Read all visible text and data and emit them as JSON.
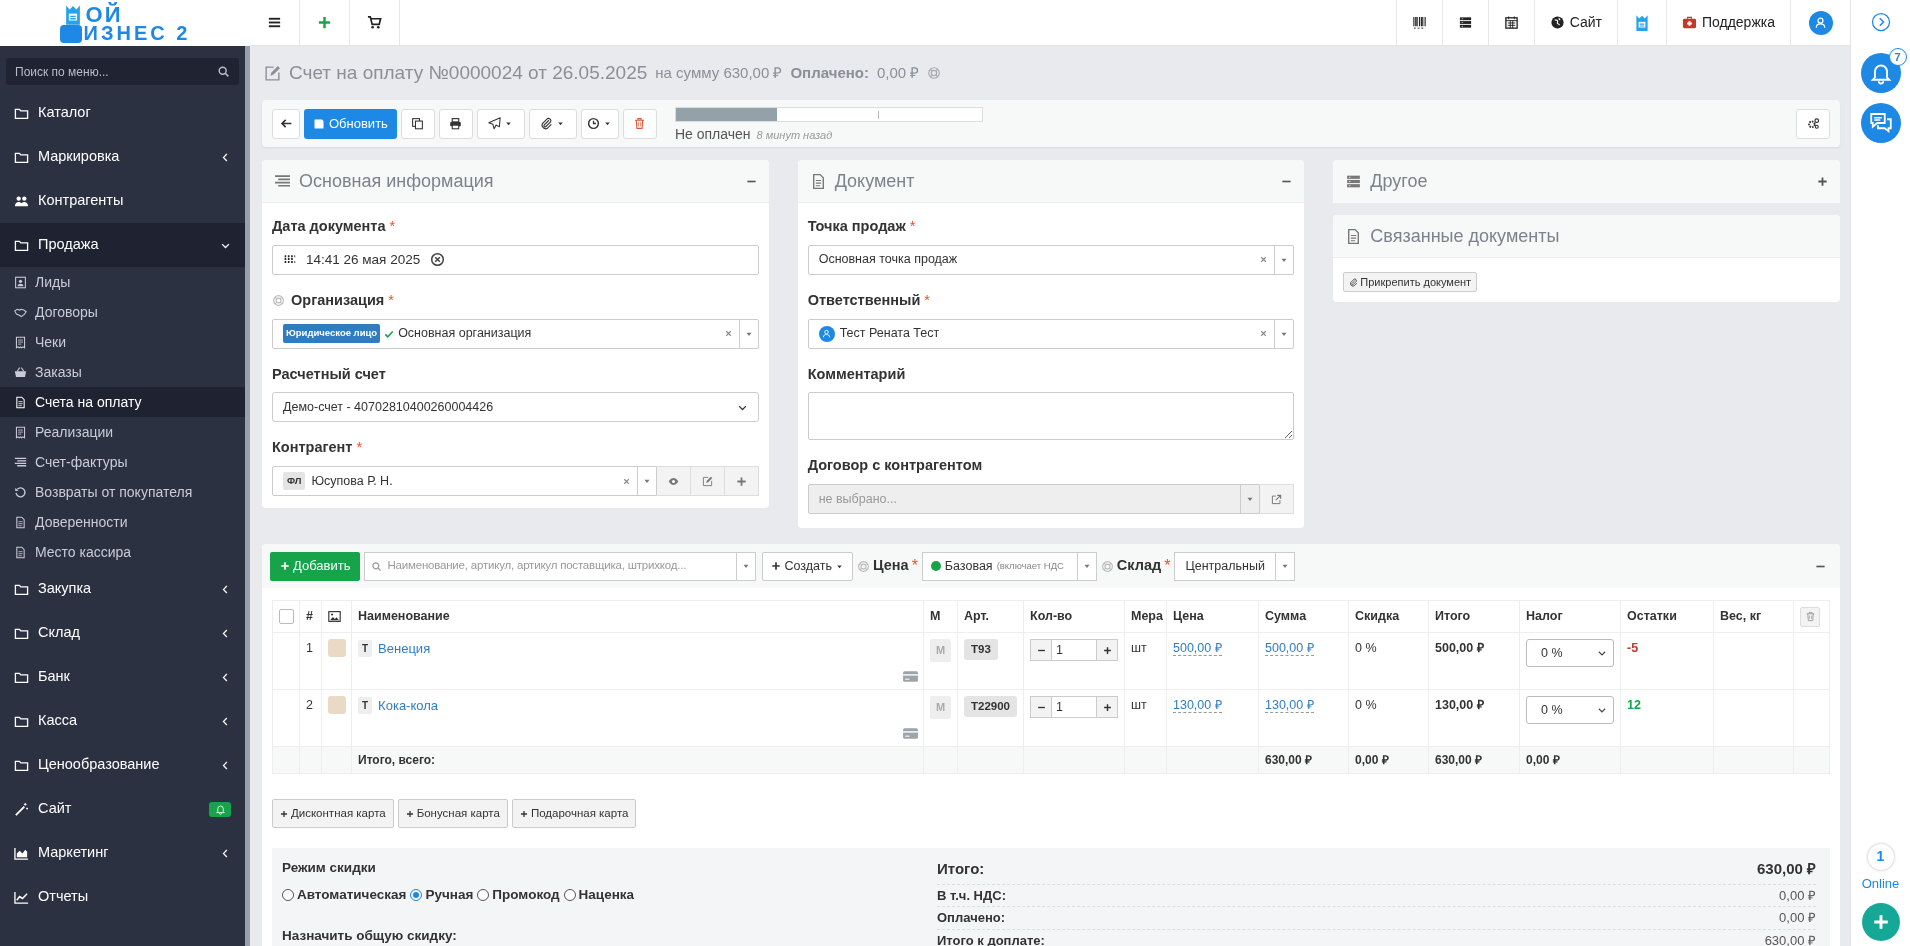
{
  "logo": {
    "line1": "ОЙ",
    "line2": "ИЗНЕС 2"
  },
  "topbar": {
    "right": [
      {
        "kind": "barcode"
      },
      {
        "kind": "list"
      },
      {
        "kind": "calendar"
      },
      {
        "kind": "globe",
        "label": "Сайт"
      },
      {
        "kind": "mascot"
      },
      {
        "kind": "support",
        "label": "Поддержка"
      },
      {
        "kind": "avatar"
      }
    ]
  },
  "sidebar": {
    "search": {
      "placeholder": "Поиск по меню..."
    },
    "items": [
      {
        "label": "Каталог",
        "kind": "link",
        "selected": false
      },
      {
        "label": "Маркировка",
        "kind": "group",
        "expanded": false,
        "selected": false
      },
      {
        "label": "Контрагенты",
        "kind": "link",
        "selected": false
      },
      {
        "label": "Продажа",
        "kind": "group",
        "expanded": true,
        "selected": true,
        "children": [
          {
            "label": "Лиды",
            "selected": false
          },
          {
            "label": "Договоры",
            "selected": false
          },
          {
            "label": "Чеки",
            "selected": false
          },
          {
            "label": "Заказы",
            "selected": false
          },
          {
            "label": "Счета на оплату",
            "selected": true
          },
          {
            "label": "Реализации",
            "selected": false
          },
          {
            "label": "Счет-фактуры",
            "selected": false
          },
          {
            "label": "Возвраты от покупателя",
            "selected": false
          },
          {
            "label": "Доверенности",
            "selected": false
          },
          {
            "label": "Место кассира",
            "selected": false
          }
        ]
      },
      {
        "label": "Закупка",
        "kind": "group",
        "expanded": false,
        "selected": false
      },
      {
        "label": "Склад",
        "kind": "group",
        "expanded": false,
        "selected": false
      },
      {
        "label": "Банк",
        "kind": "group",
        "expanded": false,
        "selected": false
      },
      {
        "label": "Касса",
        "kind": "group",
        "expanded": false,
        "selected": false
      },
      {
        "label": "Ценообразование",
        "kind": "group",
        "expanded": false,
        "selected": false
      },
      {
        "label": "Сайт",
        "kind": "badge",
        "selected": false
      },
      {
        "label": "Маркетинг",
        "kind": "group",
        "expanded": false,
        "selected": false
      },
      {
        "label": "Отчеты",
        "kind": "link",
        "selected": false
      }
    ]
  },
  "header": {
    "title": "Счет на оплату №0000024 от 26.05.2025",
    "amount": "на сумму 630,00 ₽",
    "paid_label": "Оплачено:",
    "paid_value": "0,00 ₽"
  },
  "toolbar": {
    "refresh": "Обновить",
    "progress": {
      "level": 0.33
    },
    "status": "Не оплачен",
    "time": "8 минут назад"
  },
  "main_info": {
    "title": "Основная информация",
    "collapsed": false,
    "date": {
      "label": "Дата документа",
      "required_mark": "*",
      "value": "14:41 26 мая 2025"
    },
    "organization": {
      "label": "Организация",
      "required_mark": "*",
      "tag": "Юридическое лицо",
      "value": "Основная организация"
    },
    "account": {
      "label": "Расчетный счет",
      "value": "Демо-счет - 40702810400260004426"
    },
    "counterparty": {
      "label": "Контрагент",
      "required_mark": "*",
      "tag": "ФЛ",
      "value": "Юсупова Р. Н."
    }
  },
  "document": {
    "title": "Документ",
    "collapsed": false,
    "point": {
      "label": "Точка продаж",
      "required_mark": "*",
      "value": "Основная точка продаж"
    },
    "responsible": {
      "label": "Ответственный",
      "required_mark": "*",
      "value": "Тест Рената Тест"
    },
    "comment": {
      "label": "Комментарий"
    },
    "contract": {
      "label": "Договор с контрагентом",
      "placeholder": "не выбрано...",
      "disabled": true
    }
  },
  "other": {
    "title": "Другое",
    "collapsed": true
  },
  "related": {
    "title": "Связанные документы",
    "button": "Прикрепить документ"
  },
  "products": {
    "add": "Добавить",
    "search_placeholder": "Наименование, артикул, артикул поставщика, штрихкод...",
    "create": "Создать",
    "price_label": "Цена",
    "price_mark": "*",
    "price_value": "Базовая",
    "price_note": "(включает НДС",
    "warehouse_label": "Склад",
    "warehouse_mark": "*",
    "warehouse_value": "Центральный",
    "select_all": {
      "checked": false
    },
    "columns": [
      "#",
      "Наименование",
      "М",
      "Арт.",
      "Кол-во",
      "Мера",
      "Цена",
      "Сумма",
      "Скидка",
      "Итого",
      "Налог",
      "Остатки",
      "Вес, кг"
    ],
    "rows": [
      {
        "num": "1",
        "type": "Т",
        "name": "Венеция",
        "mark": "М",
        "article": "Т93",
        "qty": "1",
        "unit": "шт",
        "price": "500,00 ₽",
        "sum": "500,00 ₽",
        "discount": "0 %",
        "total": "500,00 ₽",
        "tax": "0 %",
        "stock": "-5",
        "color": "#c0392b"
      },
      {
        "num": "2",
        "type": "Т",
        "name": "Кока-кола",
        "mark": "М",
        "article": "Т22900",
        "qty": "1",
        "unit": "шт",
        "price": "130,00 ₽",
        "sum": "130,00 ₽",
        "discount": "0 %",
        "total": "130,00 ₽",
        "tax": "0 %",
        "stock": "12",
        "color": "#16a34a"
      }
    ],
    "totals": {
      "label": "Итого, всего:",
      "sum": "630,00 ₽",
      "discount": "0,00 ₽",
      "total": "630,00 ₽",
      "tax": "0,00 ₽"
    },
    "cards": [
      "Дисконтная карта",
      "Бонусная карта",
      "Подарочная карта"
    ]
  },
  "discount": {
    "title": "Режим скидки",
    "modes": [
      {
        "label": "Автоматическая",
        "selected": false
      },
      {
        "label": "Ручная",
        "selected": true
      },
      {
        "label": "Промокод",
        "selected": false
      },
      {
        "label": "Наценка",
        "selected": false
      }
    ],
    "common_label": "Назначить общую скидку:"
  },
  "summary": [
    {
      "label": "Итого:",
      "value": "630,00 ₽",
      "kind": "main"
    },
    {
      "label": "В т.ч. НДС:",
      "value": "0,00 ₽",
      "kind": "line"
    },
    {
      "label": "Оплачено:",
      "value": "0,00 ₽",
      "kind": "line"
    },
    {
      "label": "Итого к доплате:",
      "value": "630,00 ₽",
      "kind": "line"
    }
  ],
  "rail": {
    "notifications": "7",
    "online_count": "1",
    "online_label": "Online"
  }
}
